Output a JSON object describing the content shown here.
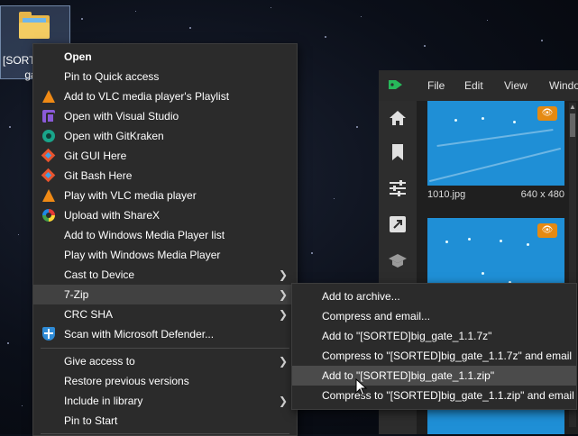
{
  "desktop": {
    "folder_label": "[SORTED]big_\ngate"
  },
  "app_window": {
    "menu": [
      "File",
      "Edit",
      "View",
      "Windo"
    ],
    "thumbnails": [
      {
        "filename": "1010.jpg",
        "dimensions": "640 x 480"
      }
    ]
  },
  "context_menu": {
    "items": [
      {
        "label": "Open",
        "icon": "",
        "bold": true,
        "submenu": false
      },
      {
        "label": "Pin to Quick access",
        "icon": "",
        "submenu": false
      },
      {
        "label": "Add to VLC media player's Playlist",
        "icon": "vlc-icon",
        "submenu": false
      },
      {
        "label": "Open with Visual Studio",
        "icon": "visual-studio-icon",
        "submenu": false
      },
      {
        "label": "Open with GitKraken",
        "icon": "gitkraken-icon",
        "submenu": false
      },
      {
        "label": "Git GUI Here",
        "icon": "git-gui-icon",
        "submenu": false
      },
      {
        "label": "Git Bash Here",
        "icon": "git-bash-icon",
        "submenu": false
      },
      {
        "label": "Play with VLC media player",
        "icon": "vlc-icon",
        "submenu": false
      },
      {
        "label": "Upload with ShareX",
        "icon": "sharex-icon",
        "submenu": false
      },
      {
        "label": "Add to Windows Media Player list",
        "icon": "",
        "submenu": false
      },
      {
        "label": "Play with Windows Media Player",
        "icon": "",
        "submenu": false
      },
      {
        "label": "Cast to Device",
        "icon": "",
        "submenu": true
      },
      {
        "label": "7-Zip",
        "icon": "",
        "submenu": true,
        "highlighted": true
      },
      {
        "label": "CRC SHA",
        "icon": "",
        "submenu": true
      },
      {
        "label": "Scan with Microsoft Defender...",
        "icon": "defender-icon",
        "submenu": false
      },
      {
        "label": "Give access to",
        "icon": "",
        "submenu": true
      },
      {
        "label": "Restore previous versions",
        "icon": "",
        "submenu": false
      },
      {
        "label": "Include in library",
        "icon": "",
        "submenu": true
      },
      {
        "label": "Pin to Start",
        "icon": "",
        "submenu": false
      }
    ]
  },
  "submenu_7zip": {
    "items": [
      {
        "label": "Add to archive..."
      },
      {
        "label": "Compress and email..."
      },
      {
        "label": "Add to \"[SORTED]big_gate_1.1.7z\""
      },
      {
        "label": "Compress to \"[SORTED]big_gate_1.1.7z\" and email"
      },
      {
        "label": "Add to \"[SORTED]big_gate_1.1.zip\"",
        "hovered": true
      },
      {
        "label": "Compress to \"[SORTED]big_gate_1.1.zip\" and email"
      }
    ]
  },
  "colors": {
    "menu_bg": "#2b2b2b",
    "menu_highlight": "#414141",
    "accent_orange": "#e58a12"
  }
}
